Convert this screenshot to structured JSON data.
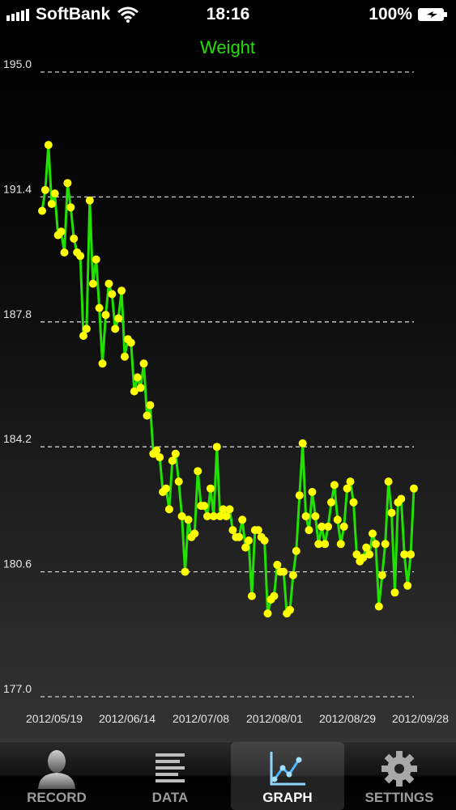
{
  "status_bar": {
    "carrier": "SoftBank",
    "time": "18:16",
    "battery": "100%",
    "signal_bars": 5
  },
  "chart_data": {
    "type": "line",
    "title": "Weight",
    "xlabel": "",
    "ylabel": "",
    "ylim": [
      177.0,
      195.0
    ],
    "y_ticks": [
      "195.0",
      "191.4",
      "187.8",
      "184.2",
      "180.6",
      "177.0"
    ],
    "x_ticks": [
      "2012/05/19",
      "2012/06/14",
      "2012/07/08",
      "2012/08/01",
      "2012/08/29",
      "2012/09/28"
    ],
    "grid": "horizontal dashed",
    "line_color": "#22e000",
    "marker_color": "#ffff00",
    "series": [
      {
        "values": [
          191.0,
          191.6,
          192.9,
          191.2,
          191.5,
          190.3,
          190.4,
          189.8,
          191.8,
          191.1,
          190.2,
          189.8,
          189.7,
          187.4,
          187.6,
          191.3,
          188.9,
          189.6,
          188.2,
          186.6,
          188.0,
          188.9,
          188.6,
          187.6,
          187.9,
          188.7,
          186.8,
          187.3,
          187.2,
          185.8,
          186.2,
          185.9,
          186.6,
          185.1,
          185.4,
          184.0,
          184.1,
          183.9,
          182.9,
          183.0,
          182.4,
          183.8,
          184.0,
          183.2,
          182.2,
          180.6,
          182.1,
          181.6,
          181.7,
          183.5,
          182.5,
          182.5,
          182.2,
          183.0,
          182.2,
          184.2,
          182.2,
          182.4,
          182.2,
          182.4,
          181.8,
          181.6,
          181.6,
          182.1,
          181.3,
          181.5,
          179.9,
          181.8,
          181.8,
          181.6,
          181.5,
          179.4,
          179.8,
          179.9,
          180.8,
          180.6,
          180.6,
          179.4,
          179.5,
          180.5,
          181.2,
          182.8,
          184.3,
          182.2,
          181.8,
          182.9,
          182.2,
          181.4,
          181.9,
          181.4,
          181.9,
          182.6,
          183.1,
          182.1,
          181.4,
          181.9,
          183.0,
          183.2,
          182.6,
          181.1,
          180.9,
          181.0,
          181.3,
          181.1,
          181.7,
          181.4,
          179.6,
          180.5,
          181.4,
          183.2,
          182.3,
          180.0,
          182.6,
          182.7,
          181.1,
          180.2,
          181.1,
          183.0
        ]
      }
    ]
  }
}
